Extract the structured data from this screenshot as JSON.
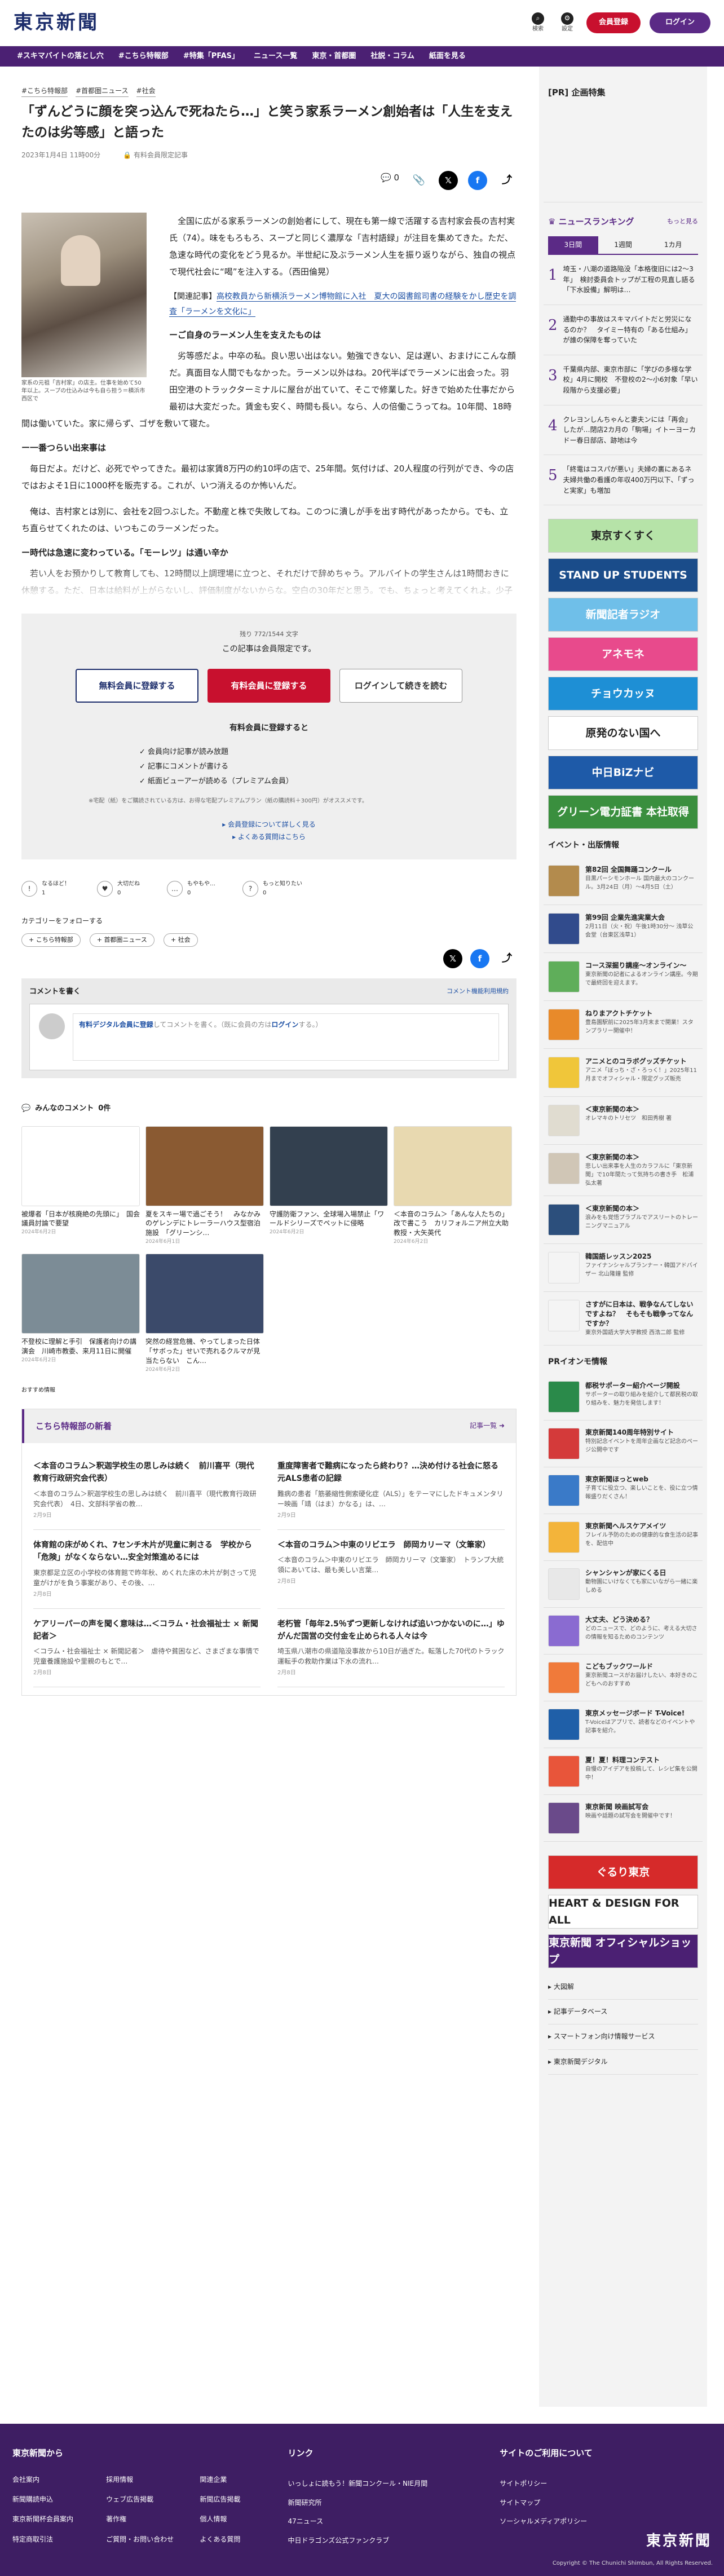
{
  "header": {
    "logo": "東京新聞",
    "search": "検索",
    "settings": "設定",
    "register": "会員登録",
    "login": "ログイン"
  },
  "nav": [
    "#スキマバイトの落とし穴",
    "#こちら特報部",
    "#特集「PFAS」",
    "ニュース一覧",
    "東京・首都圏",
    "社説・コラム",
    "紙面を見る"
  ],
  "article": {
    "tags": [
      "#こちら特報部",
      "#首都圏ニュース",
      "#社会"
    ],
    "title": "「ずんどうに顔を突っ込んで死ねたら…」と笑う家系ラーメン創始者は「人生を支えたのは劣等感」と語った",
    "date": "2023年1月4日 11時00分",
    "member": "有料会員限定記事",
    "comment_count": "0",
    "caption": "家系の元祖「吉村家」の店主。仕事を始めて50年以上。スープの仕込みは今も自ら担う＝横浜市西区で",
    "lead": "全国に広がる家系ラーメンの創始者にして、現在も第一線で活躍する吉村家会長の吉村実氏（74）。味をもろもろ、スープと同じく濃厚な「吉村語録」が注目を集めてきた。ただ、急速な時代の変化をどう見るか。半世紀に及ぶラーメン人生を振り返りながら、独自の視点で現代社会に“喝”を注入する。（西田倫晃）",
    "related_prefix": "【関連記事】",
    "related_link": "高校教員から新横浜ラーメン博物館に入社　夏大の図書館司書の経験をかし歴史を調査「ラーメンを文化に」",
    "sub1": "ーご自身のラーメン人生を支えたものは",
    "p1": "劣等感だよ。中卒の私。良い思い出はない。勉強できない、足は遅い、おまけにこんな顔だ。真面目な人間でもなかった。ラーメン以外はね。20代半ばでラーメンに出会った。羽田空港のトラックターミナルに屋台が出ていて、そこで修業した。好きで始めた仕事だから最初は大変だった。賃金も安く、時間も長い。なら、人の倍働こうってね。10年間、18時間は働いていた。家に帰らず、ゴザを敷いて寝た。",
    "sub2": "ー一番つらい出来事は",
    "p2": "毎日だよ。だけど、必死でやってきた。最初は家賃8万円の約10坪の店で、25年間。気付けば、20人程度の行列ができ、今の店ではおよそ1日に1000杯を販売する。これが、いつ消えるのか怖いんだ。",
    "p3": "俺は、吉村家とは別に、会社を2回つぶした。不動産と株で失敗してね。このつに潰しが手を出す時代があったから。でも、立ち直らせてくれたのは、いつもこのラーメンだった。",
    "sub3": "ー時代は急速に変わっている。「モーレツ」は通い辛か",
    "p4": "若い人をお預かりして教育しても、12時間以上調理場に立つと、それだけで辞めちゃう。アルバイトの学生さんは1時間おきに休憩する。ただ、日本は給料が上がらないし、評価制度がないからな。空白の30年だと思う。でも、ちょっと考えてくれよ。少子化で人口が減り、働く時間も減ったとなれば、国力も…"
  },
  "paywall": {
    "count": "残り 772/1544 文字",
    "title": "この記事は会員限定です。",
    "btn_free": "無料会員に登録する",
    "btn_paid": "有料会員に登録する",
    "btn_login": "ログインして続きを読む",
    "sub": "有料会員に登録すると",
    "benefits": [
      "会員向け記事が読み放題",
      "記事にコメントが書ける",
      "紙面ビューアーが読める（プレミアム会員）"
    ],
    "note": "※宅配（紙）をご購読されている方は、お得な宅配プレミアムプラン（紙の購読料＋300円）がオススメです。",
    "link1": "会員登録について詳しく見る",
    "link2": "よくある質問はこちら"
  },
  "reactions": [
    {
      "label": "なるほど！",
      "count": "1",
      "icon": "!"
    },
    {
      "label": "大切だね",
      "count": "0",
      "icon": "♥"
    },
    {
      "label": "もやもや…",
      "count": "0",
      "icon": "…"
    },
    {
      "label": "もっと知りたい",
      "count": "0",
      "icon": "?"
    }
  ],
  "categories": {
    "title": "カテゴリーをフォローする",
    "chips": [
      "こちら特報部",
      "首都圏ニュース",
      "社会"
    ]
  },
  "comments": {
    "write": "コメントを書く",
    "rules": "コメント機能利用規約",
    "placeholder_a": "有料デジタル会員に登録",
    "placeholder_b": "してコメントを書く。（既に会員の方は",
    "placeholder_c": "ログイン",
    "placeholder_d": "する。）",
    "all": "みんなのコメント",
    "all_count": "0件"
  },
  "recommend": [
    {
      "t": "被爆者「日本が核廃絶の先頭に」　国会議員討論で要望",
      "d": "2024年6月2日",
      "c": "#ffffff"
    },
    {
      "t": "夏をスキー場で過ごそう！　みなかみのゲレンデにトレーラーハウス型宿泊施設　「グリーンシ…",
      "d": "2024年6月1日",
      "c": "#8a5a32"
    },
    {
      "t": "守護防衛ファン、全球場入場禁止「ワールドシリーズでペットに侵略",
      "d": "2024年6月2日",
      "c": "#33404f"
    },
    {
      "t": "＜本音のコラム＞「あんな人たちの」改で書こう　カリフォルニア州立大助教授・大矢英代",
      "d": "2024年6月2日",
      "c": "#e8d9b0"
    },
    {
      "t": "不登校に理解と手引　保護者向けの講演会　川崎市教委、来月11日に開催",
      "d": "2024年6月2日",
      "c": "#7c8c96"
    },
    {
      "t": "突然の経営危機、やってしまった日体「サボった」せいで売れるクルマが見当たらない　こん…",
      "d": "2024年6月2日",
      "c": "#3b4a6a"
    }
  ],
  "osusume": "おすすめ情報",
  "tokuhobu": {
    "title": "こちら特報部の新着",
    "more": "記事一覧",
    "items": [
      {
        "t": "＜本音のコラム＞釈迦学校生の思しみは続く　前川喜平（現代教育行政研究会代表）",
        "s": "＜本音のコラム＞釈迦学校生の思しみは続く　前川喜平（現代教育行政研究会代表）　4日、文部科学省の教…",
        "d": "2月9日"
      },
      {
        "t": "重度障害者で難病になったら終わり？…決め付ける社会に怒る元ALS患者の記録",
        "s": "難病の患者「筋萎縮性側索硬化症（ALS）」をテーマにしたドキュメンタリー映画「靖（はま）かなる」は、…",
        "d": "2月9日"
      },
      {
        "t": "体育館の床がめくれ、7センチ木片が児童に刺さる　学校から「危険」がなくならない…安全対策進めるには",
        "s": "東京都足立区の小学校の体育館で昨年秋、めくれた床の木片が刺さって児童がけがを負う事案があり、その後、…",
        "d": "2月8日"
      },
      {
        "t": "＜本音のコラム＞中東のリビエラ　師岡カリーマ（文筆家）",
        "s": "＜本音のコラム＞中東のリビエラ　師岡カリーマ（文筆家）　トランプ大統領にあいては、最も美しい言葉…",
        "d": "2月8日"
      },
      {
        "t": "ケアリーパーの声を聞く意味は…＜コラム・社会福祉士 × 新聞記者＞",
        "s": "＜コラム・社会福祉士 × 新聞記者＞　虐待や貧困など、さまざまな事情で児童養護施設や里親のもとで…",
        "d": "2月8日"
      },
      {
        "t": "老朽管「毎年2.5％ずつ更新しなければ追いつかないのに…」ゆがんだ国営の交付金を止められる人々は今",
        "s": "埼玉県八潮市の県道陥没事故から10日が過ぎた。転落した70代のトラック運転手の救助作業は下水の流れ…",
        "d": "2月8日"
      }
    ]
  },
  "sidebar": {
    "pr": "[PR] 企画特集",
    "ranking": "ニュースランキング",
    "ranking_more": "もっと見る",
    "tabs": [
      "3日間",
      "1週間",
      "1カ月"
    ],
    "ranks": [
      {
        "n": "1",
        "t": "埼玉・八潮の道路陥没「本格復旧には2〜3年」　検討委員会トップが工程の見直し語る「下水設備」解明は…"
      },
      {
        "n": "2",
        "t": "通勤中の事故はスキマバイトだと労災になるのか？　タイミー特有の「ある仕組み」が誰の保障を奪っていた"
      },
      {
        "n": "3",
        "t": "千葉県内部、東京市部に「学びの多様な学校」4月に開校　不登校の2〜小6対象「早い段階から支援必要」"
      },
      {
        "n": "4",
        "t": "クレヨンしんちゃんと妻夫ンには「再会」したが…閉店2カ月の「駒場」イトーヨーカドー春日部店、跡地は今"
      },
      {
        "n": "5",
        "t": "「終電はコスパが悪い」夫婦の裏にあるネ　夫婦共働の看護の年収400万円以下、「ずっと実家」も増加"
      }
    ],
    "banners": [
      {
        "t": "東京すくすく",
        "c": "#b6e3a8"
      },
      {
        "t": "STAND UP STUDENTS",
        "c": "#1a4c8a"
      },
      {
        "t": "新聞記者ラジオ",
        "c": "#6fbfe9"
      },
      {
        "t": "アネモネ",
        "c": "#e84a8c"
      },
      {
        "t": "チョウカッヌ",
        "c": "#1e8fd5"
      },
      {
        "t": "原発のない国へ",
        "c": "#ffffff"
      },
      {
        "t": "中日BiZナビ",
        "c": "#1e5aa8"
      },
      {
        "t": "グリーン電力証書 本社取得",
        "c": "#3a8f3e"
      }
    ],
    "events_h": "イベント・出版情報",
    "events": [
      {
        "t": "第82回 全国舞踊コンクール",
        "s": "目黒パーシモンホール 国内最大のコンクール。3月24日（月）〜4月5日（土）",
        "c": "#b38b4d"
      },
      {
        "t": "第99回 企業先進実業大会",
        "s": "2月11日（火・祝）午後1時30分〜 浅草公会堂（台東区浅草1）",
        "c": "#314b8c"
      },
      {
        "t": "コース深掘り講座〜オンライン〜",
        "s": "東京新聞の記者によるオンライン講座。今期で最終回を迎えます。",
        "c": "#5fae5a"
      },
      {
        "t": "ねりまアクトチケット",
        "s": "豊島園駅前に2025年3月末まで開業！スタンプラリー開催中！",
        "c": "#e88a2a"
      },
      {
        "t": "アニメとのコラボグッズチケット",
        "s": "アニメ「ぼっち・ざ・ろっく！」2025年11月までオフィシャル・限定グッズ販売",
        "c": "#f0c63a"
      },
      {
        "t": "＜東京新聞の本＞",
        "s": "オレマキのトリセツ　和田秀樹 著",
        "c": "#e0dcd0"
      },
      {
        "t": "＜東京新聞の本＞",
        "s": "悲しい出来事を人生のカラフルに「東京新聞」で10年間たって気持ちの書き手　松浦弘太著",
        "c": "#d0c6b6"
      },
      {
        "t": "＜東京新聞の本＞",
        "s": "浪みをも覚悟プラブルでアスリートのトレーニングマニュアル",
        "c": "#2c4f7c"
      },
      {
        "t": "韓国語レッスン2025",
        "s": "ファイナンシャルプランナー・韓国アドバイザー 北山隆鐘 監修",
        "c": "#f4f4f4"
      },
      {
        "t": "さすがに日本は、戦争なんてしないですよね？　そもそも戦争ってなんですか？",
        "s": "東京外国語大学大学教授 西浩二郎 監修",
        "c": "#f4f4f4"
      }
    ],
    "pr_h": "PRイオンモ情報",
    "prs": [
      {
        "t": "都税サポーター紹介ページ開設",
        "s": "サポーターの取り組みを紹介して都民税の取り組みを、魅力を発信します！",
        "c": "#2a8a4a"
      },
      {
        "t": "東京新聞140周年特別サイト",
        "s": "特別記念イベントを周年企画など記念のページ公開中です",
        "c": "#d43a3a"
      },
      {
        "t": "東京新聞ほっとweb",
        "s": "子育てに役立つ、楽しいことを、役に立つ情報盛りだくさん！",
        "c": "#3a7ac8"
      },
      {
        "t": "東京新聞ヘルスケアメイツ",
        "s": "フレイル予防のための健康的な食生活の記事を、配信中",
        "c": "#f3b43a"
      },
      {
        "t": "シャンシャンが家にくる日",
        "s": "動物園にいけなくても家にいながら一緒に楽しめる",
        "c": "#e8e8e8"
      },
      {
        "t": "大丈夫、どう決める？",
        "s": "どのニュースで、どのように、考える大切さの情報を知るためのコンテンツ",
        "c": "#8a6bd1"
      },
      {
        "t": "こどもブックワールド",
        "s": "東京新聞ユースがお届けしたい、本好きのこどもへのおすすめ",
        "c": "#f07a3a"
      },
      {
        "t": "東京メッセージボード T-Voice!",
        "s": "T-Voiceはアプリで、読者などのイベントや記事を紹介。",
        "c": "#1f5fa8"
      },
      {
        "t": "夏！夏！料理コンテスト",
        "s": "自慢のアイデアを投稿して、レシピ集を公開中！",
        "c": "#e8553a"
      },
      {
        "t": "東京新聞 映画試写会",
        "s": "映画や話題の試写会を開催中です！",
        "c": "#6a4a8a"
      }
    ],
    "bottom_banners": [
      {
        "t": "ぐるり東京",
        "c": "#d62a2a"
      },
      {
        "t": "HEART & DESIGN FOR ALL",
        "c": "#ffffff"
      },
      {
        "t": "東京新聞 オフィシャルショップ",
        "c": "#4b2073"
      }
    ],
    "links": [
      "大図解",
      "記事データベース",
      "スマートフォン向け情報サービス",
      "東京新聞デジタル"
    ]
  },
  "footer": {
    "col1_h": "東京新聞から",
    "col1": [
      "会社案内",
      "採用情報",
      "関連企業",
      "新聞購読申込",
      "ウェブ広告掲載",
      "新聞広告掲載",
      "東京新聞杯会員案内",
      "著作権",
      "個人情報",
      "特定商取引法",
      "ご質問・お問い合わせ",
      "よくある質問"
    ],
    "col2_h": "リンク",
    "col2": [
      "いっしょに読もう！新聞コンクール・NIE月間",
      "新聞研究所",
      "47ニュース",
      "中日ドラゴンズ公式ファンクラブ"
    ],
    "col3_h": "サイトのご利用について",
    "col3": [
      "サイトポリシー",
      "サイトマップ",
      "ソーシャルメディアポリシー"
    ],
    "logo": "東京新聞",
    "copy": "Copyright © The Chunichi Shimbun, All Rights Reserved."
  }
}
